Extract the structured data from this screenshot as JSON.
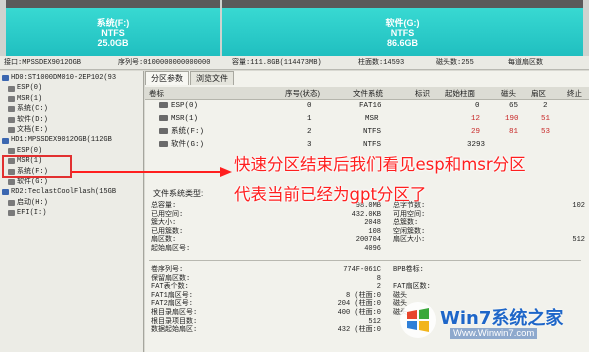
{
  "partitions_bar": [
    {
      "name": "系统(F:)",
      "fs": "NTFS",
      "size": "25.0GB"
    },
    {
      "name": "软件(G:)",
      "fs": "NTFS",
      "size": "86.6GB"
    }
  ],
  "disk_info": {
    "model": "接口:MPSSDEX9012OGB",
    "serial": "序列号:0100000000000000",
    "capacity": "容量:111.8GB(114473MB)",
    "cylinders": "柱面数:14593",
    "heads": "磁头数:255",
    "sectors": "每道扇区数"
  },
  "tree": [
    {
      "text": "HD0:ST1000DM010-2EP102(93",
      "type": "disk"
    },
    {
      "text": "ESP(0)",
      "type": "part"
    },
    {
      "text": "MSR(1)",
      "type": "part"
    },
    {
      "text": "系统(C:)",
      "type": "part"
    },
    {
      "text": "软件(D:)",
      "type": "part"
    },
    {
      "text": "文档(E:)",
      "type": "part"
    },
    {
      "text": "HD1:MPSSDEX9012OGB(112GB",
      "type": "disk"
    },
    {
      "text": "ESP(0)",
      "type": "part"
    },
    {
      "text": "MSR(1)",
      "type": "part"
    },
    {
      "text": "系统(F:)",
      "type": "part"
    },
    {
      "text": "软件(G:)",
      "type": "part"
    },
    {
      "text": "RD2:TeclastCoolFlash(15GB",
      "type": "disk"
    },
    {
      "text": "启动(H:)",
      "type": "part"
    },
    {
      "text": "EFI(I:)",
      "type": "part"
    }
  ],
  "tabs": [
    "分区参数",
    "浏览文件"
  ],
  "partition_table": {
    "headers": [
      "卷标",
      "序号(状态)",
      "文件系统",
      "标识",
      "起始柱面",
      "磁头",
      "扇区",
      "终止"
    ],
    "rows": [
      {
        "label": "ESP(0)",
        "index": "0",
        "fs": "FAT16",
        "flag": "",
        "start_cyl": "0",
        "head": "65",
        "sector": "2",
        "red": false
      },
      {
        "label": "MSR(1)",
        "index": "1",
        "fs": "MSR",
        "flag": "",
        "start_cyl": "12",
        "head": "190",
        "sector": "51",
        "red": true
      },
      {
        "label": "系统(F:)",
        "index": "2",
        "fs": "NTFS",
        "flag": "",
        "start_cyl": "29",
        "head": "81",
        "sector": "53",
        "red": true
      },
      {
        "label": "软件(G:)",
        "index": "3",
        "fs": "NTFS",
        "flag": "",
        "start_cyl": "3293",
        "head": "",
        "sector": "",
        "red": false
      }
    ]
  },
  "fs_title": "文件系统类型:",
  "fs_left": [
    {
      "k": "总容量:",
      "v": "98.0MB"
    },
    {
      "k": "已用空间:",
      "v": "432.0KB"
    },
    {
      "k": "簇大小:",
      "v": "2048"
    },
    {
      "k": "已用簇数:",
      "v": "108"
    },
    {
      "k": "扇区数:",
      "v": "200704"
    },
    {
      "k": "起始扇区号:",
      "v": "4096"
    }
  ],
  "fs_right": [
    {
      "k": "总字节数:",
      "v": "102"
    },
    {
      "k": "可用空间:",
      "v": ""
    },
    {
      "k": "总簇数:",
      "v": ""
    },
    {
      "k": "空闲簇数:",
      "v": ""
    },
    {
      "k": "扇区大小:",
      "v": "512"
    }
  ],
  "fs_lower_left": [
    {
      "k": "卷序列号:",
      "v": "774F-061C"
    },
    {
      "k": "保留扇区数:",
      "v": "8"
    },
    {
      "k": "FAT表个数:",
      "v": "2"
    },
    {
      "k": "FAT1扇区号:",
      "v": "8 (柱面:0"
    },
    {
      "k": "FAT2扇区号:",
      "v": "204 (柱面:0"
    },
    {
      "k": "根目录扇区号:",
      "v": "400 (柱面:0"
    },
    {
      "k": "根目录项目数:",
      "v": "512"
    },
    {
      "k": "数据起始扇区:",
      "v": "432 (柱面:0"
    }
  ],
  "fs_lower_right": [
    {
      "k": "BPB卷标:",
      "v": ""
    },
    {
      "k": "FAT扇区数:",
      "v": ""
    },
    {
      "k": "磁头",
      "v": ""
    },
    {
      "k": "磁头",
      "v": ""
    },
    {
      "k": "磁头",
      "v": ""
    }
  ],
  "annotation": {
    "line1": "快速分区结束后我们看见esp和msr分区",
    "line2": "代表当前已经为gpt分区了"
  },
  "watermark": {
    "brand": "Win7系统之家",
    "url": "Www.Winwin7.com"
  },
  "colors": {
    "annotation": "#ff1f1f",
    "partition_fill": "#2cc9c8",
    "red_values": "#c82828"
  }
}
